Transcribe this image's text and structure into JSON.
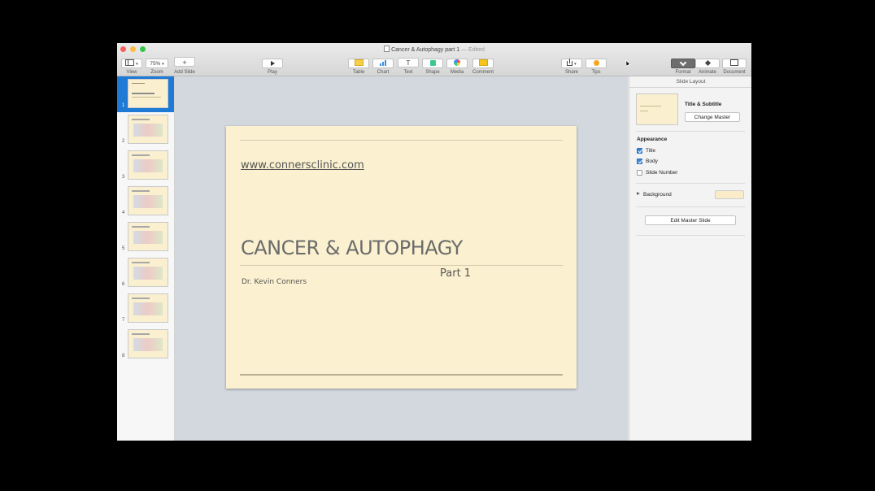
{
  "window": {
    "title": "Cancer & Autophagy part 1",
    "separator": "—",
    "status": "Edited"
  },
  "toolbar": {
    "view": {
      "label": "View",
      "icon": "sidebar-icon"
    },
    "zoom": {
      "label": "Zoom",
      "value": "75%"
    },
    "add_slide": {
      "label": "Add Slide",
      "icon": "plus-icon"
    },
    "play": {
      "label": "Play",
      "icon": "play-icon"
    },
    "table": {
      "label": "Table",
      "icon": "table-icon"
    },
    "chart": {
      "label": "Chart",
      "icon": "chart-icon"
    },
    "text": {
      "label": "Text",
      "icon": "text-icon",
      "glyph": "T"
    },
    "shape": {
      "label": "Shape",
      "icon": "shape-icon"
    },
    "media": {
      "label": "Media",
      "icon": "media-icon"
    },
    "comment": {
      "label": "Comment",
      "icon": "comment-icon"
    },
    "share": {
      "label": "Share",
      "icon": "share-icon"
    },
    "tips": {
      "label": "Tips",
      "icon": "tips-icon"
    },
    "format": {
      "label": "Format",
      "icon": "paintbrush-icon"
    },
    "animate": {
      "label": "Animate",
      "icon": "diamond-icon"
    },
    "document": {
      "label": "Document",
      "icon": "document-icon"
    }
  },
  "navigator": {
    "slides": [
      "1",
      "2",
      "3",
      "4",
      "5",
      "6",
      "7",
      "8"
    ],
    "selected": "1"
  },
  "slide": {
    "url": "www.connersclinic.com",
    "title": "CANCER & AUTOPHAGY",
    "subtitle": "Part 1",
    "author": "Dr. Kevin Conners",
    "background_color": "#fbf1d0"
  },
  "inspector": {
    "header": "Slide Layout",
    "layout_name": "Title & Subtitle",
    "change_master": "Change Master",
    "appearance_heading": "Appearance",
    "options": [
      {
        "label": "Title",
        "checked": true
      },
      {
        "label": "Body",
        "checked": true
      },
      {
        "label": "Slide Number",
        "checked": false
      }
    ],
    "background_label": "Background",
    "background_swatch": "#faecc8",
    "edit_master": "Edit Master Slide"
  },
  "colors": {
    "selection": "#1f7ad6",
    "canvas": "#d3d8df"
  }
}
